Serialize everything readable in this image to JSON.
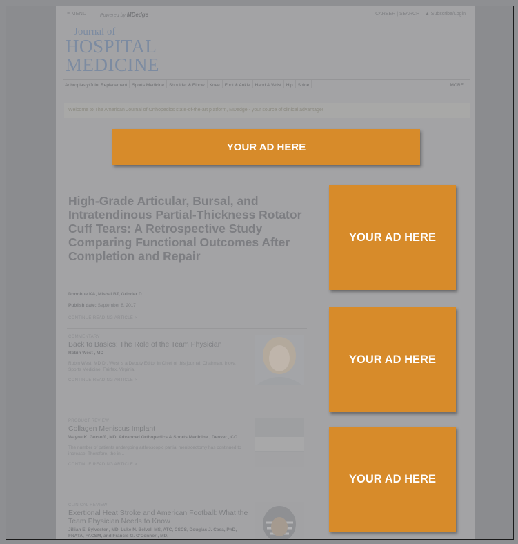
{
  "topbar": {
    "menu": "≡ MENU",
    "powered_prefix": "Powered by",
    "powered_brand": "MDedge",
    "right_links": "CAREER  |  SEARCH",
    "account": "▲  Subscribe/Login"
  },
  "journal": {
    "line1": "Journal of",
    "line2": "HOSPITAL",
    "line3": "MEDICINE"
  },
  "nav": {
    "items": [
      "Arthroplasty/Joint Replacement",
      "Sports Medicine",
      "Shoulder & Elbow",
      "Knee",
      "Foot & Ankle",
      "Hand & Wrist",
      "Hip",
      "Spine"
    ],
    "more": "MORE"
  },
  "welcome": "Welcome to The American Journal of Orthopedics state-of-the-art platform, MDedge - your source of clinical advantage!",
  "feature": {
    "headline": "High-Grade Articular, Bursal, and Intratendinous Partial-Thickness Rotator Cuff Tears: A Retrospective Study Comparing Functional Outcomes After Completion and Repair",
    "authors": "Donohue KA, Mishal BT, Grinder D",
    "pubdate_label": "Publish date:",
    "pubdate_value": "September 8, 2017",
    "continue": "CONTINUE READING ARTICLE >"
  },
  "articles": [
    {
      "kicker": "COMMENTARY",
      "title": "Back to Basics: The Role of the Team Physician",
      "byline": "Robin West , MD",
      "desc": "Robin West, MD Dr. West is a Deputy Editor in Chief of this journal; Chairman, Inova Sports Medicine, Fairfax, Virginia.",
      "continue": "CONTINUE READING ARTICLE >"
    },
    {
      "kicker": "PRODUCT REVIEW",
      "title": "Collagen Meniscus Implant",
      "byline": "Wayne K. Gersoff , MD, Advanced Orthopedics & Sports Medicine , Denver , CO",
      "desc": "The number of patients undergoing arthroscopic partial meniscectomy has continued to increase. Therefore, the in...",
      "continue": "CONTINUE READING ARTICLE >"
    },
    {
      "kicker": "CLINICAL REVIEW",
      "title": "Exertional Heat Stroke and American Football: What the Team Physician Needs to Know",
      "byline": "Jillian E. Sylvester , MD, Luke N. Belval, MS, ATC, CSCS, Douglas J. Casa, PhD, FNATA, FACSM, and Francis G. O'Connor , MD,",
      "desc": "",
      "continue": ""
    }
  ],
  "ads": {
    "banner": "YOUR AD HERE",
    "side1": "YOUR AD HERE",
    "side2": "YOUR AD HERE",
    "side3": "YOUR AD HERE"
  },
  "colors": {
    "ad_orange": "#d78b2a",
    "overlay_gray": "#a3a3a5",
    "logo_blue": "#7c8ba1"
  }
}
